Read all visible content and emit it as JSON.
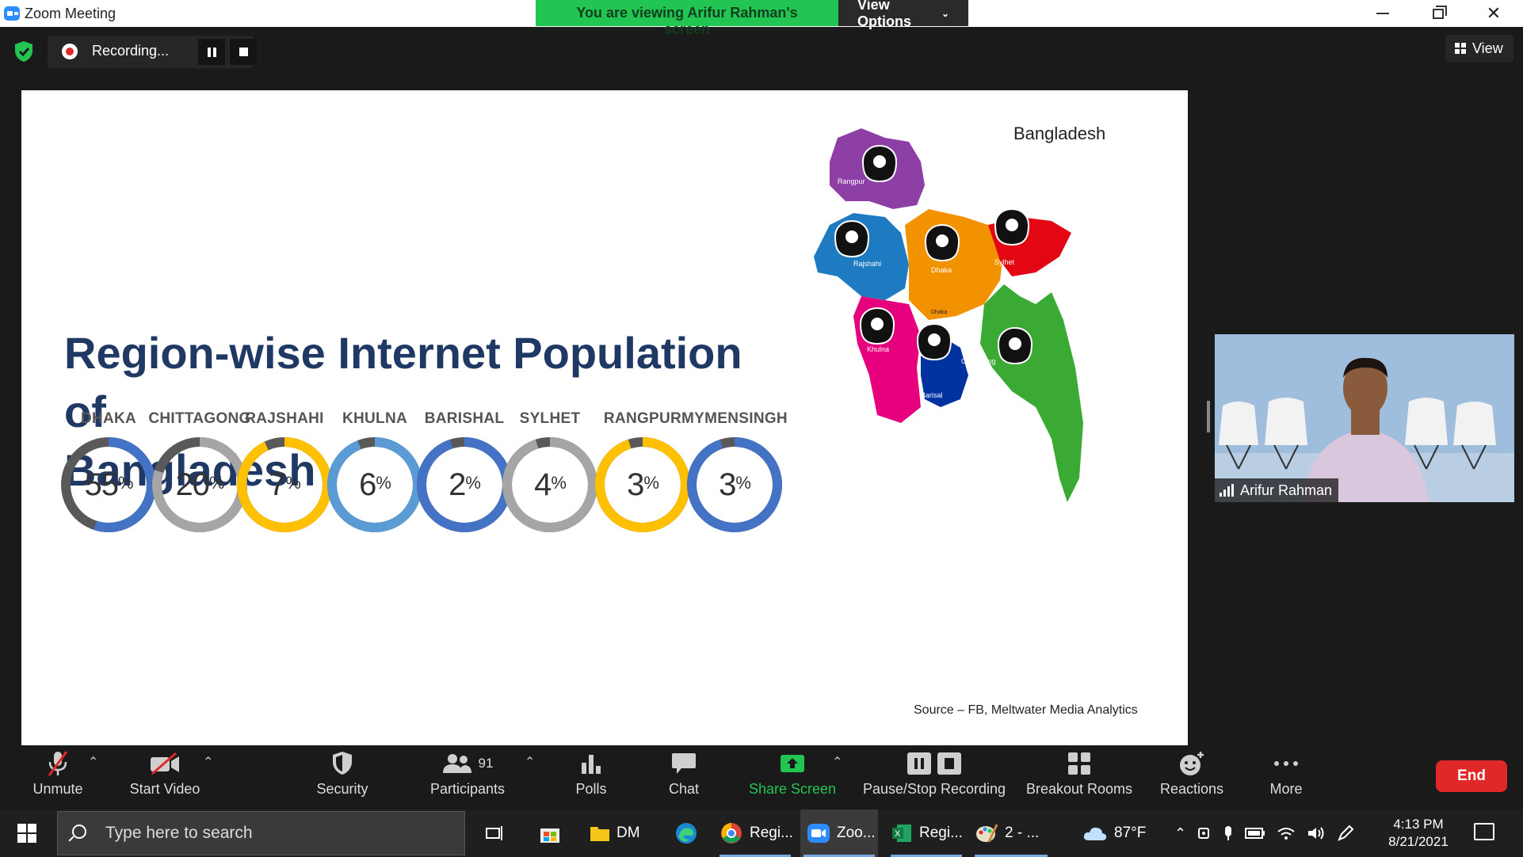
{
  "window": {
    "title": "Zoom Meeting",
    "viewing_banner": "You are viewing Arifur Rahman's screen",
    "view_options": "View Options"
  },
  "topbar": {
    "recording_label": "Recording...",
    "view_label": "View"
  },
  "slide": {
    "title_line1": "Region-wise Internet Population of",
    "title_line2": "Bangladesh",
    "map_caption": "Bangladesh",
    "source": "Source – FB, Meltwater Media Analytics",
    "map_regions": [
      "Rangpur",
      "Rajshahi",
      "Dhaka",
      "Sylhet",
      "Khulna",
      "Barisal",
      "Chittagong"
    ],
    "map_sublabels": [
      "Dhaka"
    ],
    "chart_data": {
      "type": "donut",
      "categories": [
        "DHAKA",
        "CHITTAGONG",
        "RAJSHAHI",
        "KHULNA",
        "BARISHAL",
        "SYLHET",
        "RANGPUR",
        "MYMENSINGH"
      ],
      "values": [
        55,
        20,
        7,
        6,
        2,
        4,
        3,
        3
      ],
      "value_labels": [
        "55",
        "20",
        "7",
        "6",
        "2",
        "4",
        "3",
        "3"
      ],
      "unit": "%",
      "colors": [
        "#4472c4",
        "#a5a5a5",
        "#ffc000",
        "#5b9bd5",
        "#4472c4",
        "#a5a5a5",
        "#ffc000",
        "#4472c4"
      ],
      "remainder_color": "#595959"
    }
  },
  "video": {
    "participant_name": "Arifur Rahman"
  },
  "toolbar": {
    "unmute": "Unmute",
    "start_video": "Start Video",
    "security": "Security",
    "participants": "Participants",
    "participants_count": "91",
    "polls": "Polls",
    "chat": "Chat",
    "share_screen": "Share Screen",
    "pause_stop_recording": "Pause/Stop Recording",
    "breakout_rooms": "Breakout Rooms",
    "reactions": "Reactions",
    "more": "More",
    "end": "End"
  },
  "taskbar": {
    "search_placeholder": "Type here to search",
    "items": [
      {
        "label": "DM",
        "icon": "folder-icon"
      },
      {
        "label": "Regi...",
        "icon": "chrome-icon"
      },
      {
        "label": "Zoo...",
        "icon": "zoom-icon"
      },
      {
        "label": "Regi...",
        "icon": "excel-icon"
      },
      {
        "label": "2 - ...",
        "icon": "paint-icon"
      }
    ],
    "weather": "87°F",
    "time": "4:13 PM",
    "date": "8/21/2021"
  },
  "colors": {
    "zoom_green": "#23c552",
    "zoom_blue": "#2d8cff",
    "end_red": "#e02828",
    "title_navy": "#1f3864"
  }
}
